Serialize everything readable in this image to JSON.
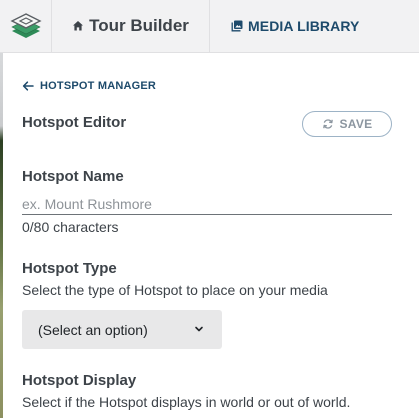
{
  "nav": {
    "logo_icon": "layers-logo-icon",
    "tour_builder_label": "Tour Builder",
    "tour_builder_icon": "home-icon",
    "media_library_label": "MEDIA LIBRARY",
    "media_library_icon": "photo-library-icon"
  },
  "breadcrumb": {
    "back_icon": "arrow-left-icon",
    "label": "HOTSPOT MANAGER"
  },
  "editor": {
    "title": "Hotspot Editor",
    "save_label": "SAVE",
    "save_icon": "sync-icon"
  },
  "form": {
    "name": {
      "label": "Hotspot Name",
      "value": "",
      "placeholder": "ex. Mount Rushmore",
      "char_count": "0/80 characters"
    },
    "type": {
      "label": "Hotspot Type",
      "description": "Select the type of Hotspot to place on your media",
      "selected": "(Select an option)",
      "dropdown_icon": "chevron-down-icon"
    },
    "display": {
      "label": "Hotspot Display",
      "description": "Select if the Hotspot displays in world or out of world."
    }
  },
  "colors": {
    "accent": "#1d4a6b",
    "topbar_bg": "#f2f2f3",
    "select_bg": "#e8e8e9",
    "logo_green": "#2e8b57"
  }
}
